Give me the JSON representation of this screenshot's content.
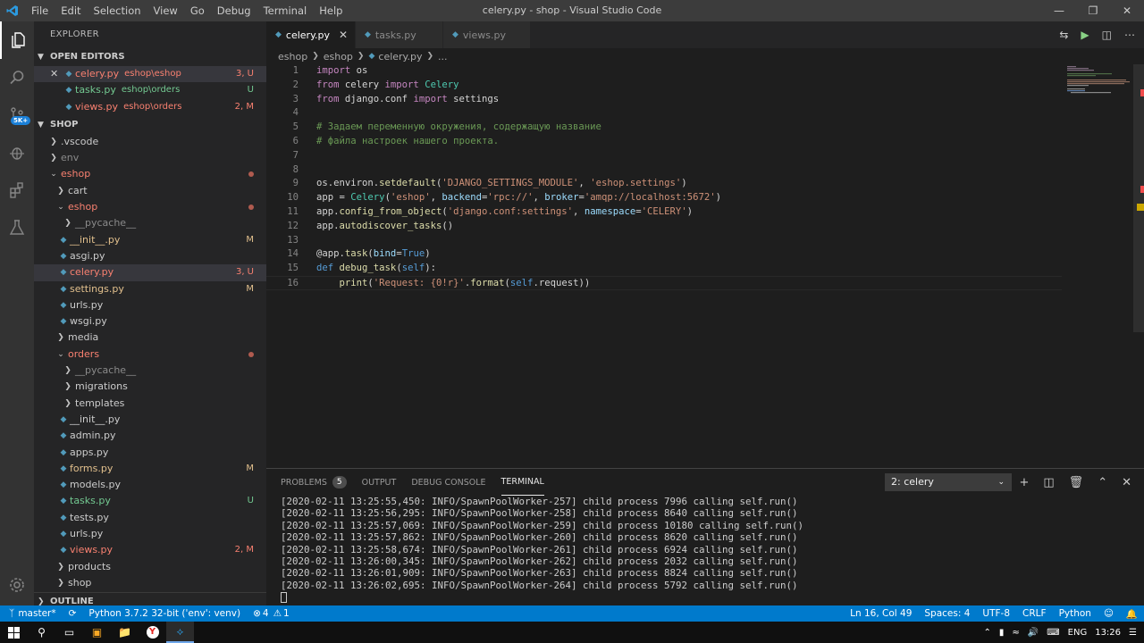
{
  "window": {
    "title": "celery.py - shop - Visual Studio Code",
    "menu": [
      "File",
      "Edit",
      "Selection",
      "View",
      "Go",
      "Debug",
      "Terminal",
      "Help"
    ]
  },
  "activity": {
    "badge": "5K+"
  },
  "sidebar": {
    "header": "EXPLORER",
    "open_editors_label": "OPEN EDITORS",
    "open_editors": [
      {
        "name": "celery.py",
        "path": "eshop\\eshop",
        "status": "3, U"
      },
      {
        "name": "tasks.py",
        "path": "eshop\\orders",
        "status": "U"
      },
      {
        "name": "views.py",
        "path": "eshop\\orders",
        "status": "2, M"
      }
    ],
    "project_label": "SHOP",
    "tree": [
      {
        "name": ".vscode",
        "status": ""
      },
      {
        "name": "env",
        "status": ""
      },
      {
        "name": "eshop",
        "status": ""
      },
      {
        "name": "cart",
        "status": ""
      },
      {
        "name": "eshop",
        "status": ""
      },
      {
        "name": "__pycache__",
        "status": ""
      },
      {
        "name": "__init__.py",
        "status": "M"
      },
      {
        "name": "asgi.py",
        "status": ""
      },
      {
        "name": "celery.py",
        "status": "3, U"
      },
      {
        "name": "settings.py",
        "status": "M"
      },
      {
        "name": "urls.py",
        "status": ""
      },
      {
        "name": "wsgi.py",
        "status": ""
      },
      {
        "name": "media",
        "status": ""
      },
      {
        "name": "orders",
        "status": ""
      },
      {
        "name": "__pycache__",
        "status": ""
      },
      {
        "name": "migrations",
        "status": ""
      },
      {
        "name": "templates",
        "status": ""
      },
      {
        "name": "__init__.py",
        "status": ""
      },
      {
        "name": "admin.py",
        "status": ""
      },
      {
        "name": "apps.py",
        "status": ""
      },
      {
        "name": "forms.py",
        "status": "M"
      },
      {
        "name": "models.py",
        "status": ""
      },
      {
        "name": "tasks.py",
        "status": "U"
      },
      {
        "name": "tests.py",
        "status": ""
      },
      {
        "name": "urls.py",
        "status": ""
      },
      {
        "name": "views.py",
        "status": "2, M"
      },
      {
        "name": "products",
        "status": ""
      },
      {
        "name": "shop",
        "status": ""
      }
    ],
    "outline_label": "OUTLINE"
  },
  "tabs": [
    {
      "label": "celery.py",
      "active": true
    },
    {
      "label": "tasks.py",
      "active": false
    },
    {
      "label": "views.py",
      "active": false
    }
  ],
  "breadcrumb": [
    "eshop",
    "eshop",
    "celery.py",
    "..."
  ],
  "code_lines": [
    "import os",
    "from celery import Celery",
    "from django.conf import settings",
    "",
    "# Задаем переменную окружения, содержащую название",
    "# файла настроек нашего проекта.",
    "",
    "",
    "os.environ.setdefault('DJANGO_SETTINGS_MODULE', 'eshop.settings')",
    "app = Celery('eshop', backend='rpc://', broker='amqp://localhost:5672')",
    "app.config_from_object('django.conf:settings', namespace='CELERY')",
    "app.autodiscover_tasks()",
    "",
    "@app.task(bind=True)",
    "def debug_task(self):",
    "    print('Request: {0!r}'.format(self.request))"
  ],
  "panel": {
    "tabs": [
      "PROBLEMS",
      "OUTPUT",
      "DEBUG CONSOLE",
      "TERMINAL"
    ],
    "problems_count": "5",
    "terminal_select": "2: celery",
    "terminal_lines": [
      "[2020-02-11 13:25:55,450: INFO/SpawnPoolWorker-257] child process 7996 calling self.run()",
      "[2020-02-11 13:25:56,295: INFO/SpawnPoolWorker-258] child process 8640 calling self.run()",
      "[2020-02-11 13:25:57,069: INFO/SpawnPoolWorker-259] child process 10180 calling self.run()",
      "[2020-02-11 13:25:57,862: INFO/SpawnPoolWorker-260] child process 8620 calling self.run()",
      "[2020-02-11 13:25:58,674: INFO/SpawnPoolWorker-261] child process 6924 calling self.run()",
      "[2020-02-11 13:26:00,345: INFO/SpawnPoolWorker-262] child process 2032 calling self.run()",
      "[2020-02-11 13:26:01,909: INFO/SpawnPoolWorker-263] child process 8824 calling self.run()",
      "[2020-02-11 13:26:02,695: INFO/SpawnPoolWorker-264] child process 5792 calling self.run()"
    ]
  },
  "status": {
    "branch": "master*",
    "python": "Python 3.7.2 32-bit ('env': venv)",
    "errors": "4",
    "warnings": "1",
    "position": "Ln 16, Col 49",
    "spaces": "Spaces: 4",
    "encoding": "UTF-8",
    "eol": "CRLF",
    "language": "Python"
  },
  "taskbar": {
    "lang": "ENG",
    "time": "13:26"
  },
  "colors": {
    "accent": "#007acc",
    "error": "#f88070",
    "modified": "#e2c08d",
    "untracked": "#73c991"
  }
}
